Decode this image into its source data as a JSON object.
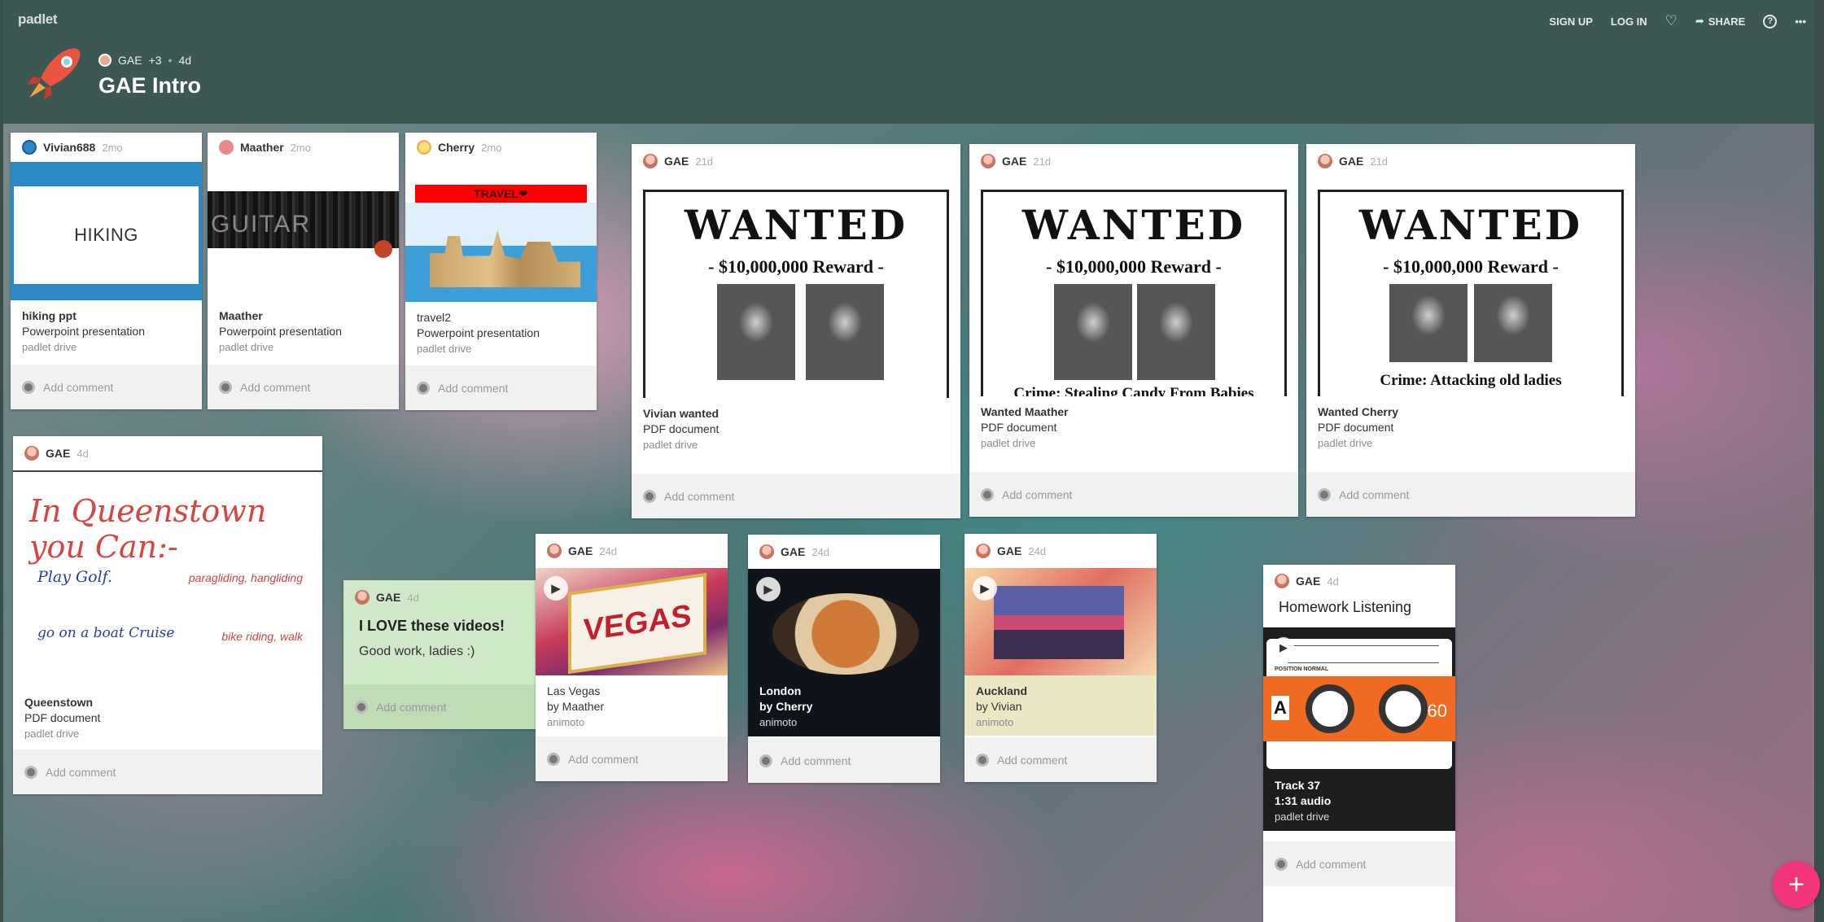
{
  "topbar": {
    "brand": "padlet",
    "sign_up": "SIGN UP",
    "log_in": "LOG IN",
    "share": "SHARE",
    "help": "?",
    "more": "•••"
  },
  "board": {
    "author": "GAE",
    "contributors": "+3",
    "age": "4d",
    "title": "GAE Intro"
  },
  "posts": {
    "hiking": {
      "author": "Vivian688",
      "time": "2mo",
      "thumb": "HIKING",
      "title": "hiking ppt",
      "type": "Powerpoint presentation",
      "source": "padlet drive"
    },
    "guitar": {
      "author": "Maather",
      "time": "2mo",
      "thumb": "GUITAR",
      "title": "Maather",
      "type": "Powerpoint presentation",
      "source": "padlet drive"
    },
    "travel": {
      "author": "Cherry",
      "time": "2mo",
      "thumb": "TRAVEL❤",
      "title": "travel2",
      "type": "Powerpoint presentation",
      "source": "padlet drive"
    },
    "vivian_wanted": {
      "author": "GAE",
      "time": "21d",
      "heading": "WANTED",
      "reward": "- $10,000,000 Reward -",
      "title": "Vivian wanted",
      "type": "PDF document",
      "source": "padlet drive"
    },
    "maather_wanted": {
      "author": "GAE",
      "time": "21d",
      "heading": "WANTED",
      "reward": "- $10,000,000 Reward -",
      "crime": "Crime: Stealing Candy From Babies",
      "title": "Wanted Maather",
      "type": "PDF document",
      "source": "padlet drive"
    },
    "cherry_wanted": {
      "author": "GAE",
      "time": "21d",
      "heading": "WANTED",
      "reward": "- $10,000,000 Reward -",
      "crime": "Crime: Attacking old ladies",
      "title": "Wanted Cherry",
      "type": "PDF document",
      "source": "padlet drive"
    },
    "queenstown": {
      "author": "GAE",
      "time": "4d",
      "big": "In Queenstown you Can:-",
      "s1": "Play Golf.",
      "s2": "go on a boat Cruise",
      "s3": "paragliding, hangliding",
      "s4": "bike riding, walk",
      "title": "Queenstown",
      "type": "PDF document",
      "source": "padlet drive"
    },
    "note": {
      "author": "GAE",
      "time": "4d",
      "title": "I LOVE these videos!",
      "body": "Good work, ladies :)"
    },
    "vegas": {
      "author": "GAE",
      "time": "24d",
      "thumb": "VEGAS",
      "title": "Las Vegas",
      "by": "by Maather",
      "source": "animoto"
    },
    "london": {
      "author": "GAE",
      "time": "24d",
      "title": "London",
      "by": "by Cherry",
      "source": "animoto"
    },
    "auckland": {
      "author": "GAE",
      "time": "24d",
      "title": "Auckland",
      "by": "by Vivian",
      "source": "animoto"
    },
    "homework": {
      "author": "GAE",
      "time": "4d",
      "heading": "Homework Listening",
      "side": "A",
      "minutes": "60",
      "label_left": "POSITION NORMAL",
      "title": "Track 37",
      "type": "1:31 audio",
      "source": "padlet drive"
    }
  },
  "comment_placeholder": "Add comment",
  "fab": "+"
}
